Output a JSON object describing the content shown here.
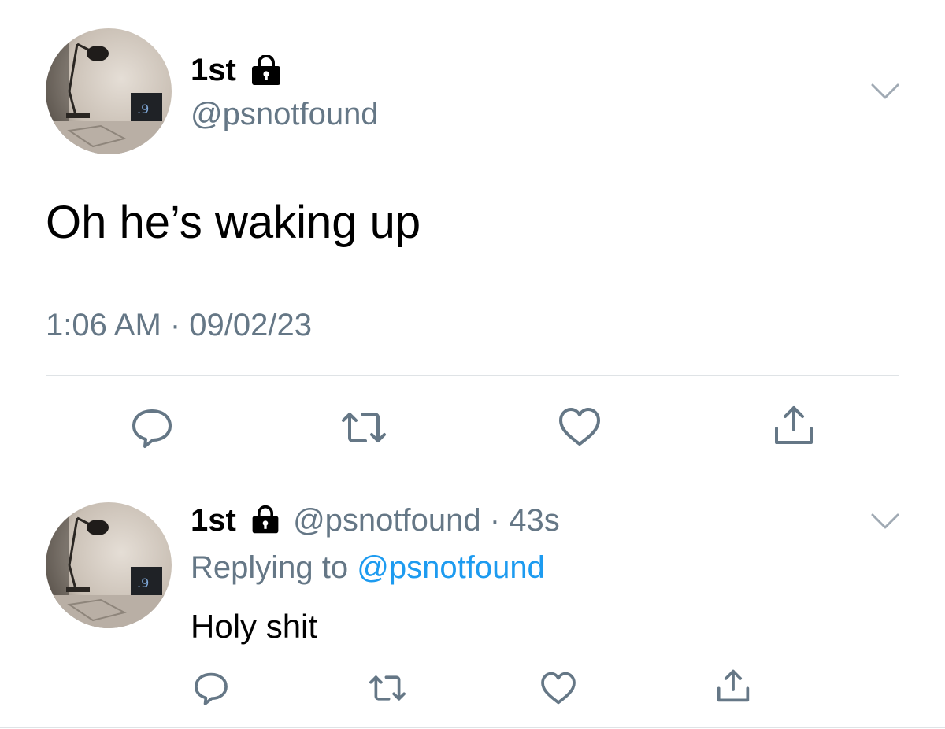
{
  "main_tweet": {
    "display_name": "1st",
    "handle": "@psnotfound",
    "text": "Oh he’s waking up",
    "timestamp": "1:06 AM · 09/02/23",
    "avatar_icon": "desk-lamp-avatar",
    "lock_icon": "lock-icon",
    "menu_icon": "chevron-down-icon",
    "actions": [
      "reply-icon",
      "retweet-icon",
      "like-icon",
      "share-icon"
    ]
  },
  "reply_tweet": {
    "display_name": "1st",
    "handle": "@psnotfound",
    "separator": "·",
    "time_ago": "43s",
    "replying_prefix": "Replying to",
    "replying_to": "@psnotfound",
    "text": "Holy shit",
    "avatar_icon": "desk-lamp-avatar",
    "lock_icon": "lock-icon",
    "menu_icon": "chevron-down-icon",
    "actions": [
      "reply-icon",
      "retweet-icon",
      "like-icon",
      "share-icon"
    ]
  },
  "colors": {
    "text": "#000000",
    "muted": "#657786",
    "link": "#1d9bf0",
    "divider": "#dfe3e6"
  }
}
